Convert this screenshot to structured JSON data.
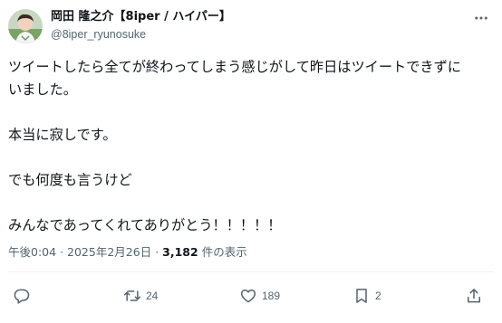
{
  "author": {
    "display_name": "岡田 隆之介【8iper / ハイパー】",
    "handle": "@8iper_ryunosuke"
  },
  "tweet": {
    "lines": [
      "ツイートしたら全てが終わってしまう感じがして昨日はツイートできずに",
      "いました。",
      "",
      "本当に寂しです。",
      "",
      "でも何度も言うけど",
      "",
      "みんなであってくれてありがとう！！！！！"
    ]
  },
  "meta": {
    "time": "午後0:04",
    "separator": "·",
    "date": "2025年2月26日",
    "views_count": "3,182",
    "views_label": "件の表示"
  },
  "actions": {
    "reply_count": "",
    "retweet_count": "24",
    "like_count": "189",
    "bookmark_count": "2"
  },
  "icons": {
    "more": "more-horizontal-icon",
    "reply": "reply-icon",
    "retweet": "retweet-icon",
    "like": "heart-icon",
    "bookmark": "bookmark-icon",
    "share": "share-icon"
  },
  "colors": {
    "text_primary": "#0f1419",
    "text_secondary": "#536471",
    "divider": "#eff3f4"
  }
}
